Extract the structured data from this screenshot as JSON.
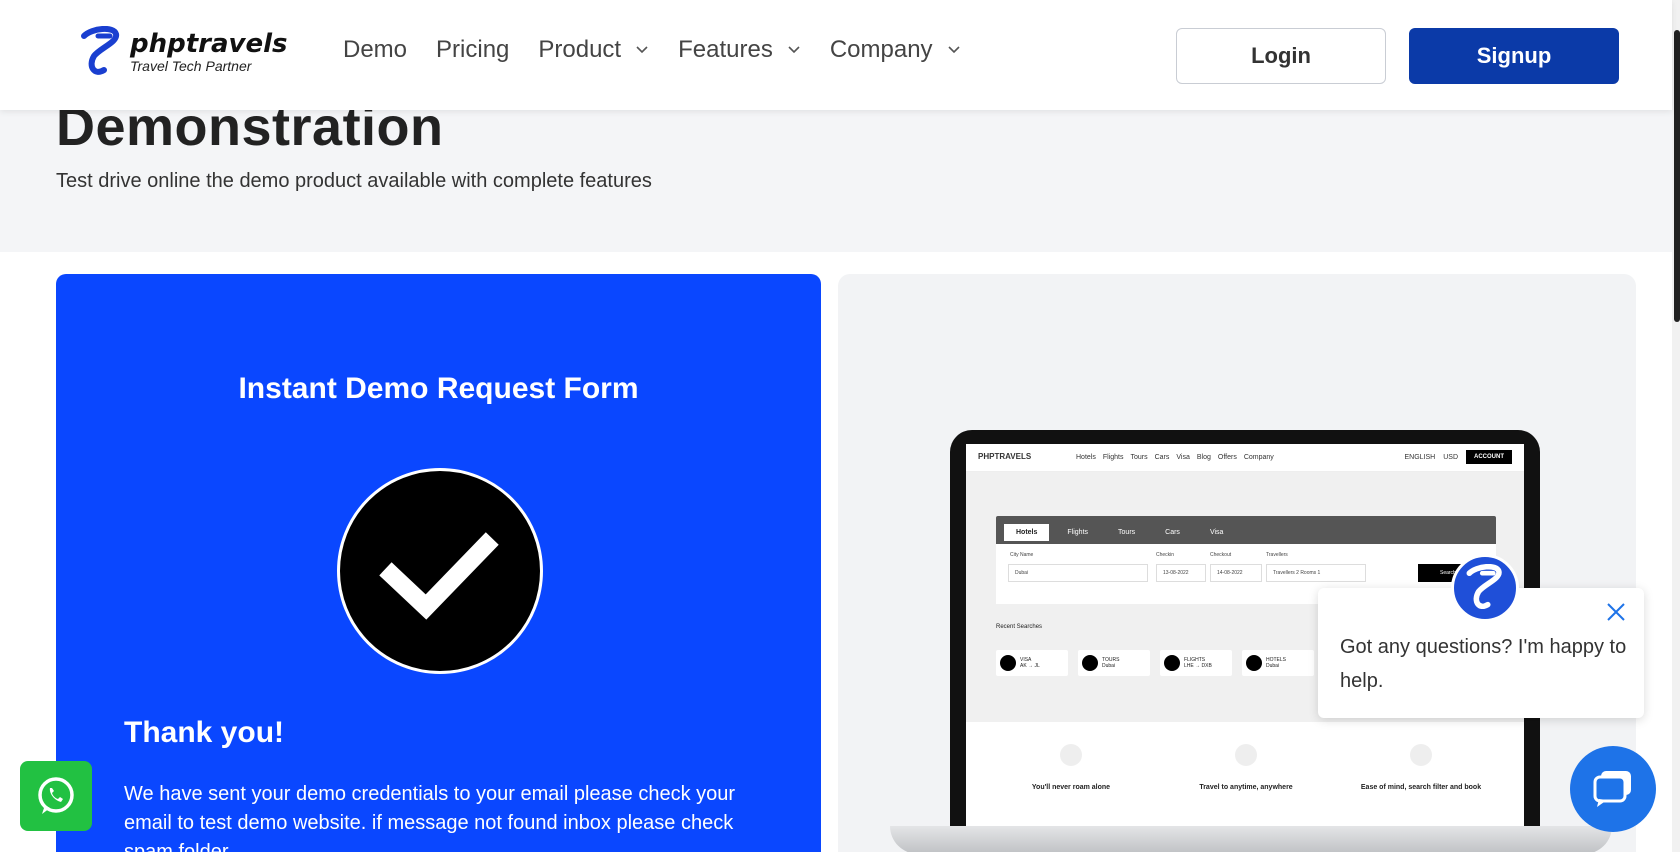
{
  "header": {
    "logo_name": "phptravels",
    "logo_tagline": "Travel Tech Partner",
    "nav": [
      {
        "label": "Demo",
        "has_dropdown": false
      },
      {
        "label": "Pricing",
        "has_dropdown": false
      },
      {
        "label": "Product",
        "has_dropdown": true
      },
      {
        "label": "Features",
        "has_dropdown": true
      },
      {
        "label": "Company",
        "has_dropdown": true
      }
    ],
    "login_label": "Login",
    "signup_label": "Signup"
  },
  "hero": {
    "title": "Demonstration",
    "subtitle": "Test drive online the demo product available with complete features"
  },
  "demo_form": {
    "title": "Instant Demo Request Form",
    "thanks_title": "Thank you!",
    "thanks_message": "We have sent your demo credentials to your email please check your email to test demo website. if message not found inbox please check spam folder"
  },
  "laptop_preview": {
    "logo": "PHPTRAVELS",
    "links": [
      "Hotels",
      "Flights",
      "Tours",
      "Cars",
      "Visa",
      "Blog",
      "Offers",
      "Company"
    ],
    "language": "ENGLISH",
    "currency": "USD",
    "account": "ACCOUNT",
    "tabs": [
      "Hotels",
      "Flights",
      "Tours",
      "Cars",
      "Visa"
    ],
    "city_label": "City Name",
    "city_value": "Dubai",
    "checkin_label": "Checkin",
    "checkin_value": "13-08-2022",
    "checkout_label": "Checkout",
    "checkout_value": "14-08-2022",
    "travellers_label": "Travellers",
    "travellers_value": "Travellers 2 Rooms 1",
    "search_label": "Search",
    "recent_label": "Recent Searches",
    "recent": [
      {
        "title": "VISA",
        "sub": "AK → JL"
      },
      {
        "title": "TOURS",
        "sub": "Dubai"
      },
      {
        "title": "FLIGHTS",
        "sub": "LHE → DXB"
      },
      {
        "title": "HOTELS",
        "sub": "Dubai"
      }
    ],
    "features": [
      "You'll never roam alone",
      "Travel to anytime, anywhere",
      "Ease of mind, search filter and book"
    ]
  },
  "chat": {
    "message": "Got any questions? I'm happy to help."
  },
  "colors": {
    "brand_blue": "#0b3aa8",
    "card_blue": "#0a47ff",
    "whatsapp_green": "#22c142",
    "chat_blue": "#1e73e8"
  }
}
